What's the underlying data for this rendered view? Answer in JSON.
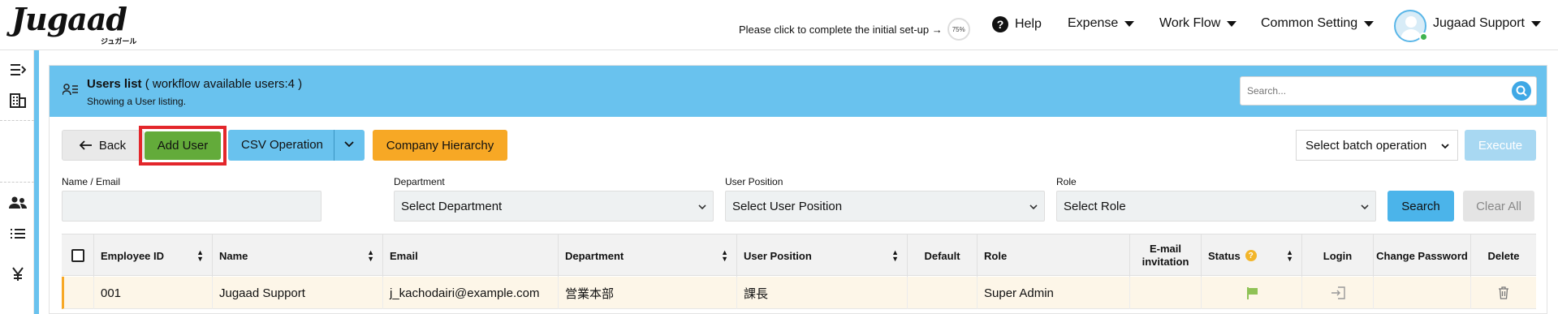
{
  "header": {
    "logo_text": "Jugaad",
    "logo_kana": "ジュガール",
    "setup_text": "Please click to complete the initial set-up →",
    "setup_progress": "75%",
    "help_label": "Help",
    "nav": [
      "Expense",
      "Work Flow",
      "Common Setting"
    ],
    "user_name": "Jugaad Support"
  },
  "panel": {
    "title": "Users list",
    "title_suffix": "( workflow available users:4 )",
    "subtitle": "Showing a User listing.",
    "search_placeholder": "Search..."
  },
  "toolbar": {
    "back_label": "Back",
    "add_user_label": "Add User",
    "csv_label": "CSV Operation",
    "hierarchy_label": "Company Hierarchy",
    "batch_select": "Select batch operation",
    "execute_label": "Execute"
  },
  "filters": {
    "name_label": "Name / Email",
    "department_label": "Department",
    "department_value": "Select Department",
    "position_label": "User Position",
    "position_value": "Select User Position",
    "role_label": "Role",
    "role_value": "Select Role",
    "search_label": "Search",
    "clear_label": "Clear All"
  },
  "table": {
    "headers": {
      "employee_id": "Employee ID",
      "name": "Name",
      "email": "Email",
      "department": "Department",
      "user_position": "User Position",
      "default": "Default",
      "role": "Role",
      "email_invitation": "E-mail invitation",
      "status": "Status",
      "login": "Login",
      "change_password": "Change Password",
      "delete": "Delete"
    },
    "rows": [
      {
        "employee_id": "001",
        "name": "Jugaad Support",
        "email": "j_kachodairi@example.com",
        "department": "営業本部",
        "user_position": "課長",
        "default": "",
        "role": "Super Admin"
      }
    ]
  },
  "colors": {
    "accent_blue": "#69c2ee",
    "add_green": "#63ab3a",
    "highlight_red": "#e3262b",
    "hierarchy_orange": "#f7a825"
  }
}
